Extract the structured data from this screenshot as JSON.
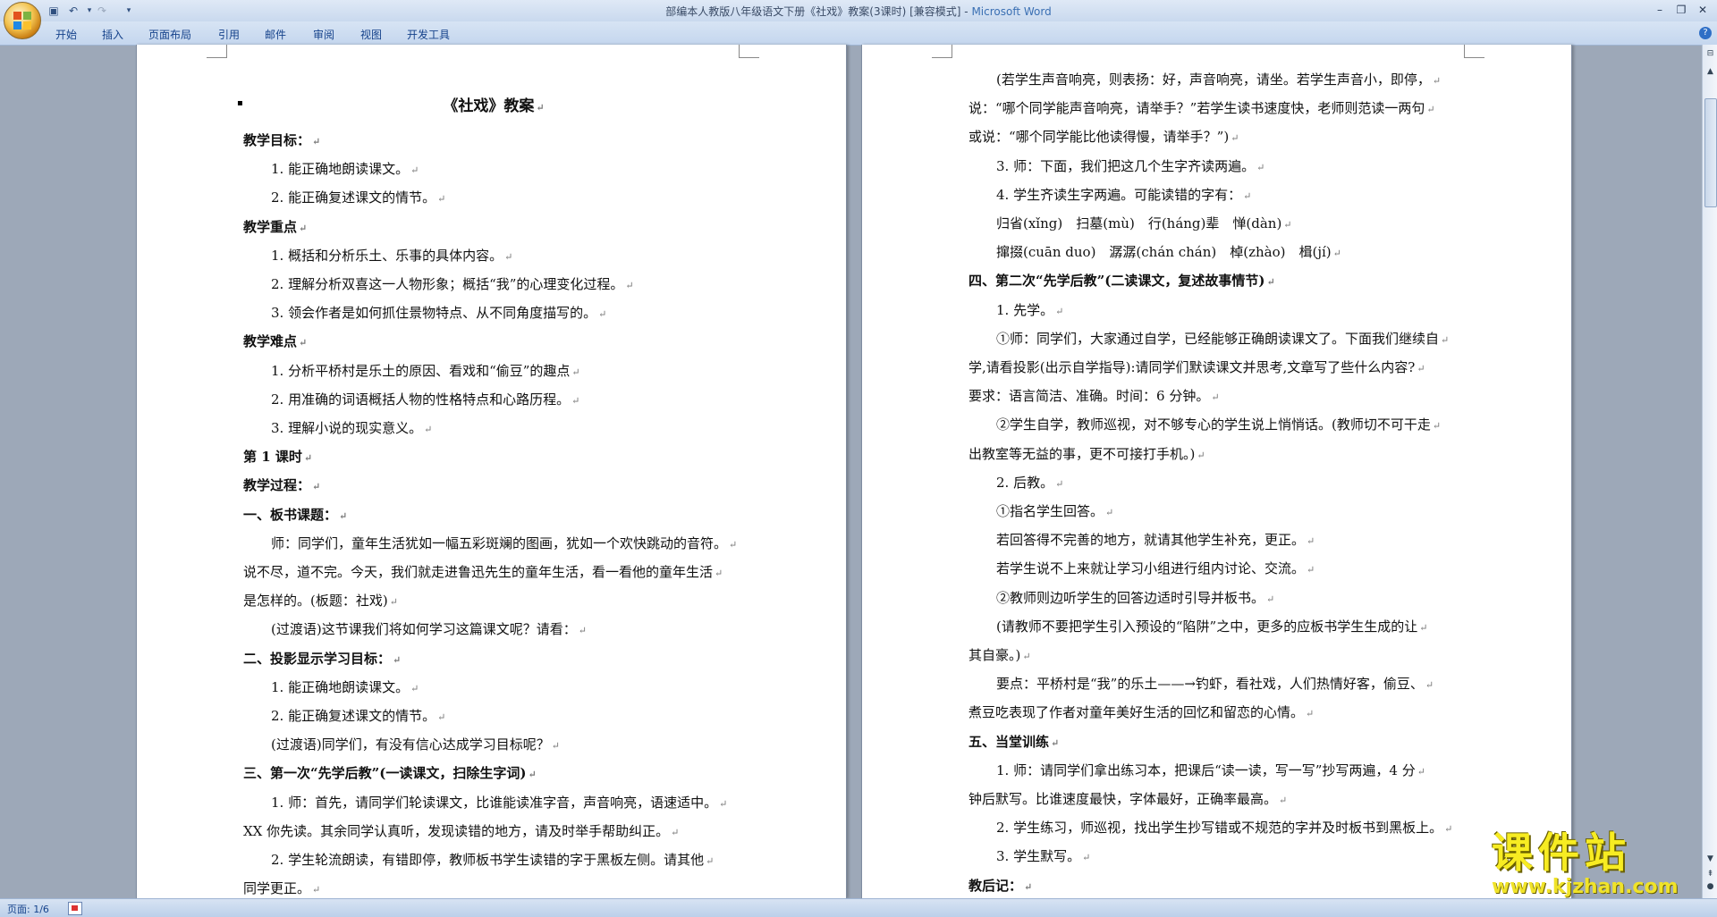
{
  "window": {
    "title": "部编本人教版八年级语文下册《社戏》教案(3课时) [兼容模式]",
    "app": "Microsoft Word"
  },
  "ribbon": {
    "tabs": [
      "开始",
      "插入",
      "页面布局",
      "引用",
      "邮件",
      "审阅",
      "视图",
      "开发工具"
    ]
  },
  "left_page": {
    "title": "《社戏》教案",
    "lines": [
      {
        "text": "教学目标：",
        "bold": true,
        "indent": false
      },
      {
        "text": "1. 能正确地朗读课文。",
        "bold": false,
        "indent": true
      },
      {
        "text": "2. 能正确复述课文的情节。",
        "bold": false,
        "indent": true
      },
      {
        "text": "教学重点",
        "bold": true,
        "indent": false
      },
      {
        "text": "1. 概括和分析乐土、乐事的具体内容。",
        "bold": false,
        "indent": true
      },
      {
        "text": "2. 理解分析双喜这一人物形象；概括“我”的心理变化过程。",
        "bold": false,
        "indent": true
      },
      {
        "text": "3. 领会作者是如何抓住景物特点、从不同角度描写的。",
        "bold": false,
        "indent": true
      },
      {
        "text": "教学难点",
        "bold": true,
        "indent": false
      },
      {
        "text": "1. 分析平桥村是乐土的原因、看戏和“偷豆”的趣点",
        "bold": false,
        "indent": true
      },
      {
        "text": "2. 用准确的词语概括人物的性格特点和心路历程。",
        "bold": false,
        "indent": true
      },
      {
        "text": "3. 理解小说的现实意义。",
        "bold": false,
        "indent": true
      },
      {
        "text": "第 1 课时",
        "bold": true,
        "indent": false
      },
      {
        "text": "教学过程：",
        "bold": true,
        "indent": false
      },
      {
        "text": "一、板书课题：",
        "bold": true,
        "indent": false
      },
      {
        "text": "师：同学们，童年生活犹如一幅五彩斑斓的图画，犹如一个欢快跳动的音符。",
        "bold": false,
        "indent": true
      },
      {
        "text": "说不尽，道不完。今天，我们就走进鲁迅先生的童年生活，看一看他的童年生活",
        "bold": false,
        "indent": false
      },
      {
        "text": "是怎样的。(板题：社戏)",
        "bold": false,
        "indent": false
      },
      {
        "text": "(过渡语)这节课我们将如何学习这篇课文呢？请看：",
        "bold": false,
        "indent": true
      },
      {
        "text": "二、投影显示学习目标：",
        "bold": true,
        "indent": false
      },
      {
        "text": "1. 能正确地朗读课文。",
        "bold": false,
        "indent": true
      },
      {
        "text": "2. 能正确复述课文的情节。",
        "bold": false,
        "indent": true
      },
      {
        "text": "(过渡语)同学们，有没有信心达成学习目标呢？",
        "bold": false,
        "indent": true
      },
      {
        "text": "三、第一次“先学后教”(一读课文，扫除生字词)",
        "bold": true,
        "indent": false
      },
      {
        "text": "1. 师：首先，请同学们轮读课文，比谁能读准字音，声音响亮，语速适中。",
        "bold": false,
        "indent": true
      },
      {
        "text": "XX 你先读。其余同学认真听，发现读错的地方，请及时举手帮助纠正。",
        "bold": false,
        "indent": false
      },
      {
        "text": "2. 学生轮流朗读，有错即停，教师板书学生读错的字于黑板左侧。请其他",
        "bold": false,
        "indent": true
      },
      {
        "text": "同学更正。",
        "bold": false,
        "indent": false
      }
    ]
  },
  "right_page": {
    "lines": [
      {
        "text": "(若学生声音响亮，则表扬：好，声音响亮，请坐。若学生声音小，即停，",
        "bold": false,
        "indent": true
      },
      {
        "text": "说：“哪个同学能声音响亮，请举手？”若学生读书速度快，老师则范读一两句",
        "bold": false,
        "indent": false
      },
      {
        "text": "或说：“哪个同学能比他读得慢，请举手？”)",
        "bold": false,
        "indent": false
      },
      {
        "text": "3. 师：下面，我们把这几个生字齐读两遍。",
        "bold": false,
        "indent": true
      },
      {
        "text": "4. 学生齐读生字两遍。可能读错的字有：",
        "bold": false,
        "indent": true
      },
      {
        "text": "归省(xǐng)　扫墓(mù)　行(háng)辈　惮(dàn)",
        "bold": false,
        "indent": true
      },
      {
        "text": "撺掇(cuān duo)　潺潺(chán chán)　棹(zhào)　楫(jí)",
        "bold": false,
        "indent": true
      },
      {
        "text": "四、第二次“先学后教”(二读课文，复述故事情节)",
        "bold": true,
        "indent": false
      },
      {
        "text": "1. 先学。",
        "bold": false,
        "indent": true
      },
      {
        "text": "①师：同学们，大家通过自学，已经能够正确朗读课文了。下面我们继续自",
        "bold": false,
        "indent": true
      },
      {
        "text": "学,请看投影(出示自学指导):请同学们默读课文并思考,文章写了些什么内容?",
        "bold": false,
        "indent": false
      },
      {
        "text": "要求：语言简洁、准确。时间：6 分钟。",
        "bold": false,
        "indent": false
      },
      {
        "text": "②学生自学，教师巡视，对不够专心的学生说上悄悄话。(教师切不可干走",
        "bold": false,
        "indent": true
      },
      {
        "text": "出教室等无益的事，更不可接打手机。)",
        "bold": false,
        "indent": false
      },
      {
        "text": "2. 后教。",
        "bold": false,
        "indent": true
      },
      {
        "text": "①指名学生回答。",
        "bold": false,
        "indent": true
      },
      {
        "text": "若回答得不完善的地方，就请其他学生补充，更正。",
        "bold": false,
        "indent": true
      },
      {
        "text": "若学生说不上来就让学习小组进行组内讨论、交流。",
        "bold": false,
        "indent": true
      },
      {
        "text": "②教师则边听学生的回答边适时引导并板书。",
        "bold": false,
        "indent": true
      },
      {
        "text": "(请教师不要把学生引入预设的“陷阱”之中，更多的应板书学生生成的让",
        "bold": false,
        "indent": true
      },
      {
        "text": "其自豪。)",
        "bold": false,
        "indent": false
      },
      {
        "text": "要点：平桥村是“我”的乐土——→钓虾，看社戏，人们热情好客，偷豆、",
        "bold": false,
        "indent": true
      },
      {
        "text": "煮豆吃表现了作者对童年美好生活的回忆和留恋的心情。",
        "bold": false,
        "indent": false
      },
      {
        "text": "五、当堂训练",
        "bold": true,
        "indent": false
      },
      {
        "text": "1. 师：请同学们拿出练习本，把课后“读一读，写一写”抄写两遍，4 分",
        "bold": false,
        "indent": true
      },
      {
        "text": "钟后默写。比谁速度最快，字体最好，正确率最高。",
        "bold": false,
        "indent": false
      },
      {
        "text": "2. 学生练习，师巡视，找出学生抄写错或不规范的字并及时板书到黑板上。",
        "bold": false,
        "indent": true
      },
      {
        "text": "3. 学生默写。",
        "bold": false,
        "indent": true
      },
      {
        "text": "教后记：",
        "bold": true,
        "indent": false
      }
    ]
  },
  "status": {
    "page_info": "页面: 1/6"
  },
  "watermark": {
    "text": "课件站",
    "url": "www.kjzhan.com"
  }
}
